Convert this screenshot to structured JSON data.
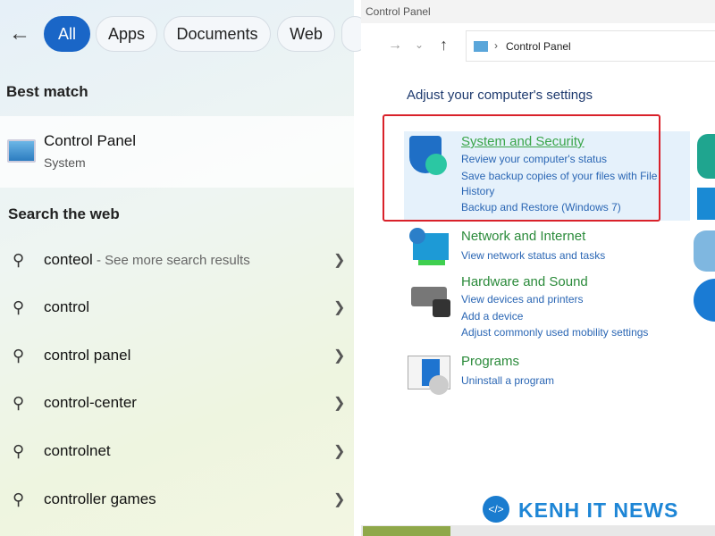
{
  "search": {
    "tabs": [
      "All",
      "Apps",
      "Documents",
      "Web"
    ],
    "best_match_heading": "Best match",
    "best_match": {
      "title": "Control Panel",
      "subtitle": "System"
    },
    "web_heading": "Search the web",
    "web_results": [
      {
        "text": "conteol",
        "suffix": " - See more search results"
      },
      {
        "text": "control"
      },
      {
        "text": "control panel"
      },
      {
        "text": "control-center"
      },
      {
        "text": "controlnet"
      },
      {
        "text": "controller games"
      }
    ]
  },
  "control_panel": {
    "window_title": "Control Panel",
    "address": "Control Panel",
    "heading": "Adjust your computer's settings",
    "highlight_color": "#d9212a",
    "categories": [
      {
        "title": "System and Security",
        "links": [
          "Review your computer's status",
          "Save backup copies of your files with File",
          "History",
          "Backup and Restore (Windows 7)"
        ]
      },
      {
        "title": "Network and Internet",
        "links": [
          "View network status and tasks"
        ]
      },
      {
        "title": "Hardware and Sound",
        "links": [
          "View devices and printers",
          "Add a device",
          "Adjust commonly used mobility settings"
        ]
      },
      {
        "title": "Programs",
        "links": [
          "Uninstall a program"
        ]
      }
    ]
  },
  "watermark": "KENH IT NEWS"
}
